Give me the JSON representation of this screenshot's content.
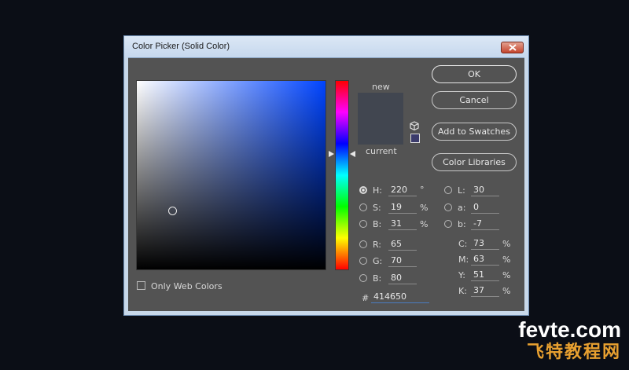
{
  "window": {
    "title": "Color Picker (Solid Color)"
  },
  "swatches": {
    "new_label": "new",
    "current_label": "current",
    "new_color": "#414650",
    "current_color": "#414650"
  },
  "buttons": {
    "ok": "OK",
    "cancel": "Cancel",
    "add_swatches": "Add to Swatches",
    "color_libraries": "Color Libraries"
  },
  "hsb": {
    "h": {
      "label": "H:",
      "value": "220",
      "unit": "°"
    },
    "s": {
      "label": "S:",
      "value": "19",
      "unit": "%"
    },
    "b": {
      "label": "B:",
      "value": "31",
      "unit": "%"
    }
  },
  "rgb": {
    "r": {
      "label": "R:",
      "value": "65"
    },
    "g": {
      "label": "G:",
      "value": "70"
    },
    "b": {
      "label": "B:",
      "value": "80"
    }
  },
  "lab": {
    "l": {
      "label": "L:",
      "value": "30"
    },
    "a": {
      "label": "a:",
      "value": "0"
    },
    "b": {
      "label": "b:",
      "value": "-7"
    }
  },
  "cmyk": {
    "c": {
      "label": "C:",
      "value": "73",
      "unit": "%"
    },
    "m": {
      "label": "M:",
      "value": "63",
      "unit": "%"
    },
    "y": {
      "label": "Y:",
      "value": "51",
      "unit": "%"
    },
    "k": {
      "label": "K:",
      "value": "37",
      "unit": "%"
    }
  },
  "hex": {
    "label": "#",
    "value": "414650"
  },
  "web_colors": {
    "label": "Only Web Colors",
    "checked": false
  },
  "watermark": {
    "top": "fevte.com",
    "bottom": "飞特教程网"
  },
  "icons": {
    "close": "close-icon",
    "cube": "cube-icon",
    "websafe": "websafe-swatch-icon"
  }
}
